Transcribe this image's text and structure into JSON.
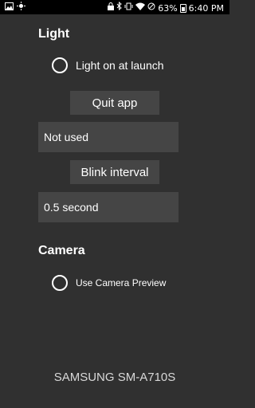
{
  "status_bar": {
    "left_icons": [
      "gallery-icon",
      "brightness-icon"
    ],
    "battery_percent": "63%",
    "time": "6:40 PM",
    "right_icons": [
      "lock-icon",
      "bluetooth-icon",
      "vibrate-icon",
      "wifi-icon",
      "dnd-icon",
      "battery-icon"
    ]
  },
  "light": {
    "title": "Light",
    "launch_option": "Light on at launch",
    "quit_button": "Quit app",
    "quit_value": "Not used",
    "blink_button": "Blink interval",
    "blink_value": "0.5 second"
  },
  "camera": {
    "title": "Camera",
    "preview_option": "Use Camera Preview"
  },
  "device_name": "SAMSUNG SM-A710S"
}
